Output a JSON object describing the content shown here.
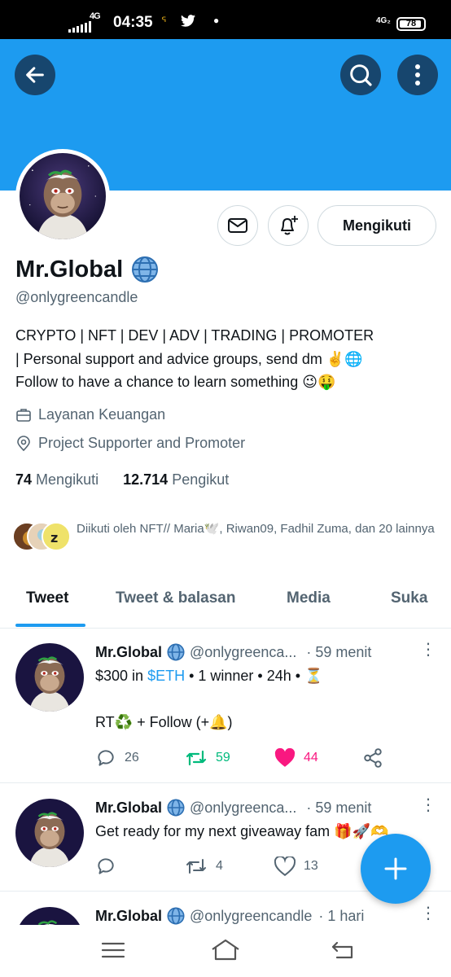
{
  "status_bar": {
    "network_left": "4G",
    "time": "04:35",
    "network_right": "4G₂",
    "battery": "78"
  },
  "profile": {
    "name": "Mr.Global",
    "handle": "@onlygreencandle",
    "follow_button": "Mengikuti",
    "bio": {
      "line1": "CRYPTO | NFT | DEV | ADV | TRADING | PROMOTER",
      "line2": "|  Personal support and advice groups, send dm ✌️🌐",
      "line3": "Follow to have a chance to learn something 😉🤑"
    },
    "category": "Layanan Keuangan",
    "location": "Project Supporter and Promoter",
    "following_count": "74",
    "following_label": "Mengikuti",
    "followers_count": "12.714",
    "followers_label": "Pengikut",
    "followed_by": "Diikuti oleh NFT// Maria🕊️, Riwan09, Fadhil Zuma, dan 20 lainnya"
  },
  "tabs": [
    {
      "label": "Tweet"
    },
    {
      "label": "Tweet & balasan"
    },
    {
      "label": "Media"
    },
    {
      "label": "Suka"
    }
  ],
  "tweets": [
    {
      "name": "Mr.Global",
      "handle": "@onlygreenca...",
      "time": "· 59 menit",
      "text_prefix": "$300 in ",
      "text_link": "$ETH",
      "text_suffix": " • 1 winner • 24h • ⏳",
      "text_line2": "RT♻️ + Follow (+🔔)",
      "replies": "26",
      "retweets": "59",
      "likes": "44"
    },
    {
      "name": "Mr.Global",
      "handle": "@onlygreenca...",
      "time": "· 59 menit",
      "text": "Get ready for my next giveaway fam 🎁🚀🫶",
      "replies": "",
      "retweets": "4",
      "likes": "13"
    },
    {
      "name": "Mr.Global",
      "handle": "@onlygreencandle",
      "time": "· 1 hari"
    }
  ],
  "colors": {
    "brand_blue": "#1d9bf0",
    "retweet_green": "#00ba7c",
    "like_pink": "#f91880",
    "button_dark": "#17466e"
  }
}
